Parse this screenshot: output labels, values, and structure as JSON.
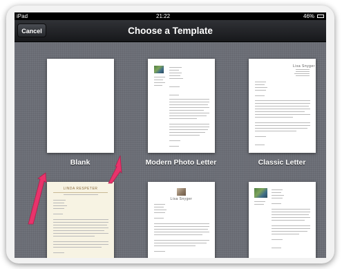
{
  "status": {
    "carrier": "iPad",
    "time": "21:22",
    "battery": "46%"
  },
  "nav": {
    "cancel_label": "Cancel",
    "title": "Choose a Template"
  },
  "templates": [
    {
      "label": "Blank"
    },
    {
      "label": "Modern Photo Letter"
    },
    {
      "label": "Classic Letter"
    },
    {
      "label": ""
    },
    {
      "label": ""
    },
    {
      "label": ""
    }
  ],
  "previews": {
    "classic_name": "Lisa Snyger",
    "modern_name": "Lisa Snyger",
    "cream_name": "LINDA RESPETER"
  },
  "colors": {
    "screen": "#6b6e76",
    "navbar": "#1f2023",
    "arrow": "#e8336b"
  }
}
